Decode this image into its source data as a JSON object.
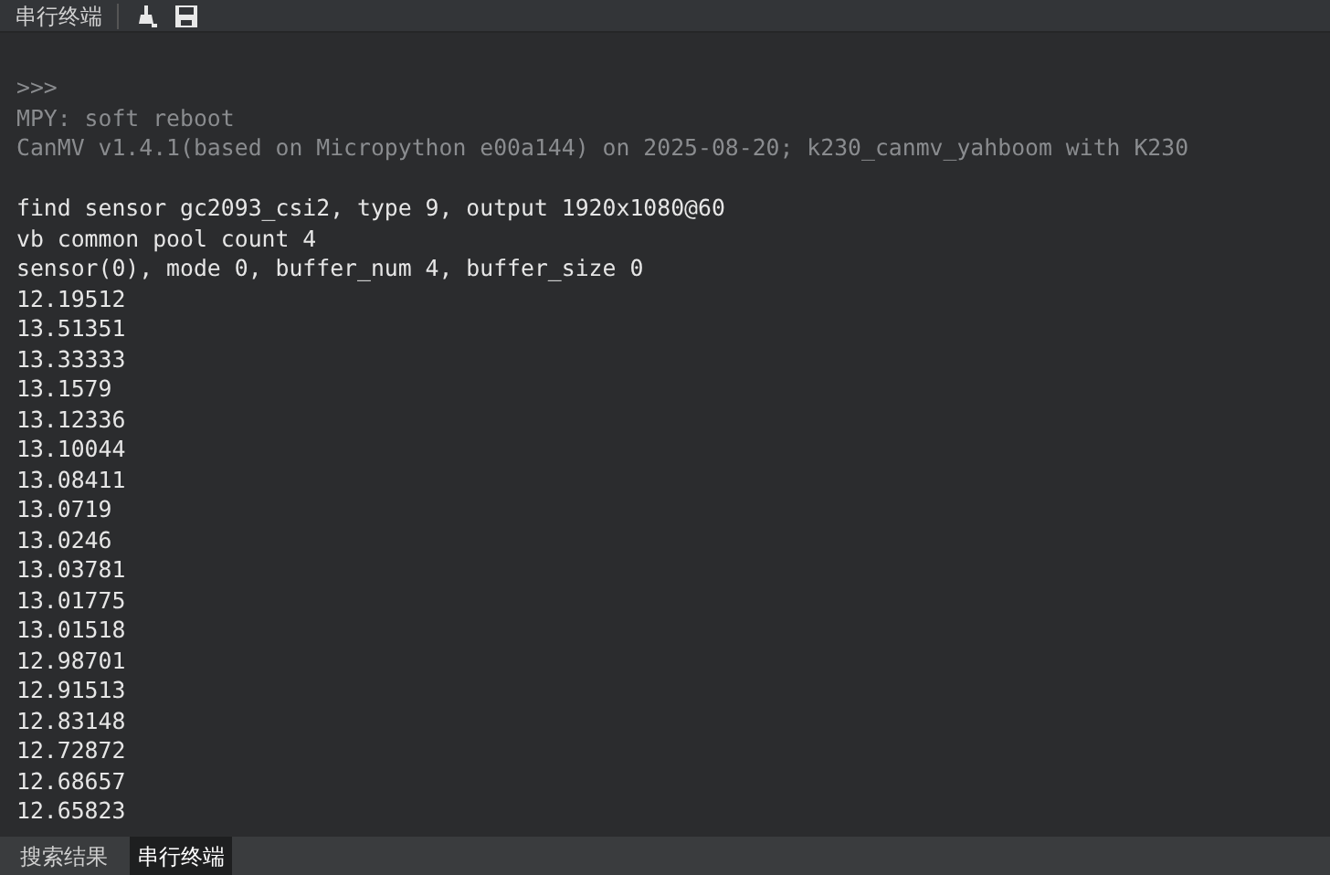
{
  "toolbar": {
    "title": "串行终端"
  },
  "terminal": {
    "lines": [
      {
        "text": ">>>",
        "kind": "dim"
      },
      {
        "text": "MPY: soft reboot",
        "kind": "dim"
      },
      {
        "text": "CanMV v1.4.1(based on Micropython e00a144) on 2025-08-20; k230_canmv_yahboom with K230",
        "kind": "dim"
      },
      {
        "kind": "blank"
      },
      {
        "text": "find sensor gc2093_csi2, type 9, output 1920x1080@60",
        "kind": "out"
      },
      {
        "text": "vb common pool count 4",
        "kind": "out"
      },
      {
        "text": "sensor(0), mode 0, buffer_num 4, buffer_size 0",
        "kind": "out"
      },
      {
        "text": "12.19512",
        "kind": "out"
      },
      {
        "text": "13.51351",
        "kind": "out"
      },
      {
        "text": "13.33333",
        "kind": "out"
      },
      {
        "text": "13.1579",
        "kind": "out"
      },
      {
        "text": "13.12336",
        "kind": "out"
      },
      {
        "text": "13.10044",
        "kind": "out"
      },
      {
        "text": "13.08411",
        "kind": "out"
      },
      {
        "text": "13.0719",
        "kind": "out"
      },
      {
        "text": "13.0246",
        "kind": "out"
      },
      {
        "text": "13.03781",
        "kind": "out"
      },
      {
        "text": "13.01775",
        "kind": "out"
      },
      {
        "text": "13.01518",
        "kind": "out"
      },
      {
        "text": "12.98701",
        "kind": "out"
      },
      {
        "text": "12.91513",
        "kind": "out"
      },
      {
        "text": "12.83148",
        "kind": "out"
      },
      {
        "text": "12.72872",
        "kind": "out"
      },
      {
        "text": "12.68657",
        "kind": "out"
      },
      {
        "text": "12.65823",
        "kind": "out"
      }
    ]
  },
  "bottom_tabs": [
    {
      "label": "搜索结果",
      "selected": false
    },
    {
      "label": "串行终端",
      "selected": true
    }
  ]
}
